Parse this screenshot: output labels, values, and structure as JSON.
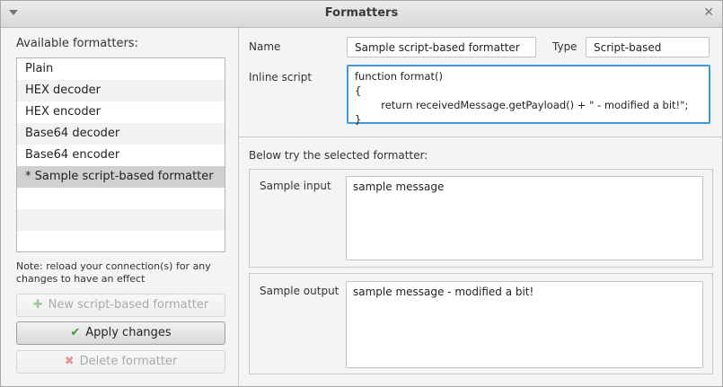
{
  "window": {
    "title": "Formatters"
  },
  "left_panel": {
    "available_label": "Available formatters:",
    "formatters": [
      "Plain",
      "HEX decoder",
      "HEX encoder",
      "Base64 decoder",
      "Base64 encoder",
      "* Sample script-based formatter"
    ],
    "selected_index": 5,
    "note": "Note: reload your connection(s) for any changes to have an effect",
    "buttons": {
      "new_label": "New script-based formatter",
      "apply_label": "Apply changes",
      "delete_label": "Delete formatter"
    }
  },
  "details": {
    "name_label": "Name",
    "name_value": "Sample script-based formatter",
    "type_label": "Type",
    "type_value": "Script-based",
    "inline_script_label": "Inline script",
    "inline_script": "function format()\n{\n        return receivedMessage.getPayload() + \" - modified a bit!\";\n}"
  },
  "tester": {
    "title": "Below try the selected formatter:",
    "sample_input_label": "Sample input",
    "sample_input_value": "sample message",
    "sample_output_label": "Sample output",
    "sample_output_value": "sample message - modified a bit!"
  },
  "icons": {
    "menu": "chevron-down-icon",
    "close": "close-icon",
    "new": "plus-icon",
    "apply": "check-icon",
    "delete": "cross-icon"
  },
  "colors": {
    "selection": "#d0d0d0",
    "focus_border": "#3f99d6",
    "apply_check": "#3d9a3d"
  }
}
